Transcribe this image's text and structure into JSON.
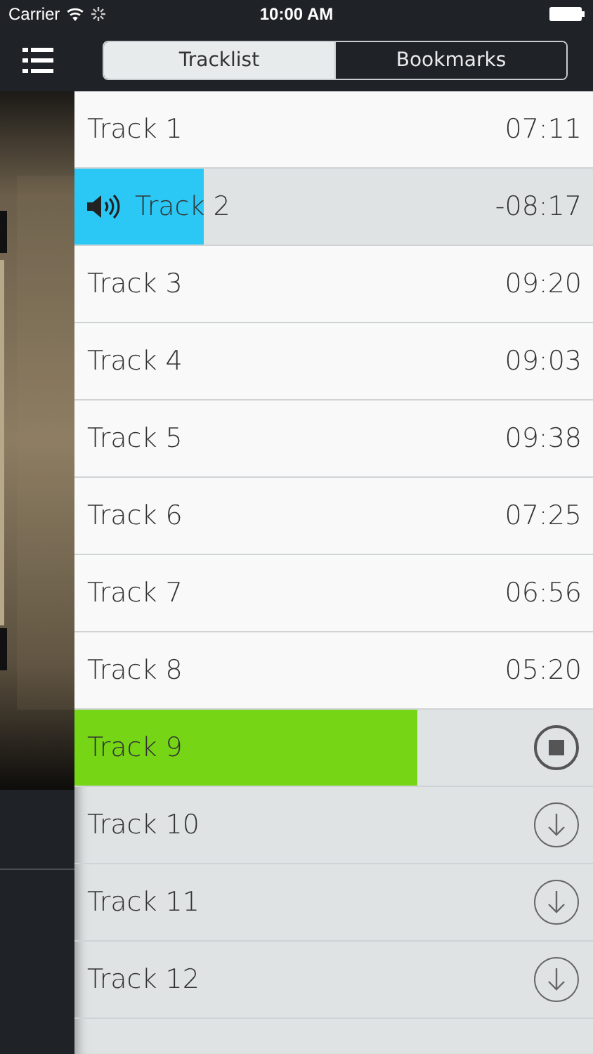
{
  "status_bar": {
    "carrier": "Carrier",
    "time": "10:00 AM"
  },
  "tabs": [
    {
      "label": "Tracklist",
      "selected": true
    },
    {
      "label": "Bookmarks",
      "selected": false
    }
  ],
  "tracks": [
    {
      "title": "Track 1",
      "kind": "downloaded",
      "time": "07:11"
    },
    {
      "title": "Track 2",
      "kind": "playing",
      "time": "-08:17",
      "level": 0.25
    },
    {
      "title": "Track 3",
      "kind": "downloaded",
      "time": "09:20"
    },
    {
      "title": "Track 4",
      "kind": "downloaded",
      "time": "09:03"
    },
    {
      "title": "Track 5",
      "kind": "downloaded",
      "time": "09:38"
    },
    {
      "title": "Track 6",
      "kind": "downloaded",
      "time": "07:25"
    },
    {
      "title": "Track 7",
      "kind": "downloaded",
      "time": "06:56"
    },
    {
      "title": "Track 8",
      "kind": "downloaded",
      "time": "05:20"
    },
    {
      "title": "Track 9",
      "kind": "downloading",
      "level": 0.66
    },
    {
      "title": "Track 10",
      "kind": "remote"
    },
    {
      "title": "Track 11",
      "kind": "remote"
    },
    {
      "title": "Track 12",
      "kind": "remote"
    }
  ]
}
